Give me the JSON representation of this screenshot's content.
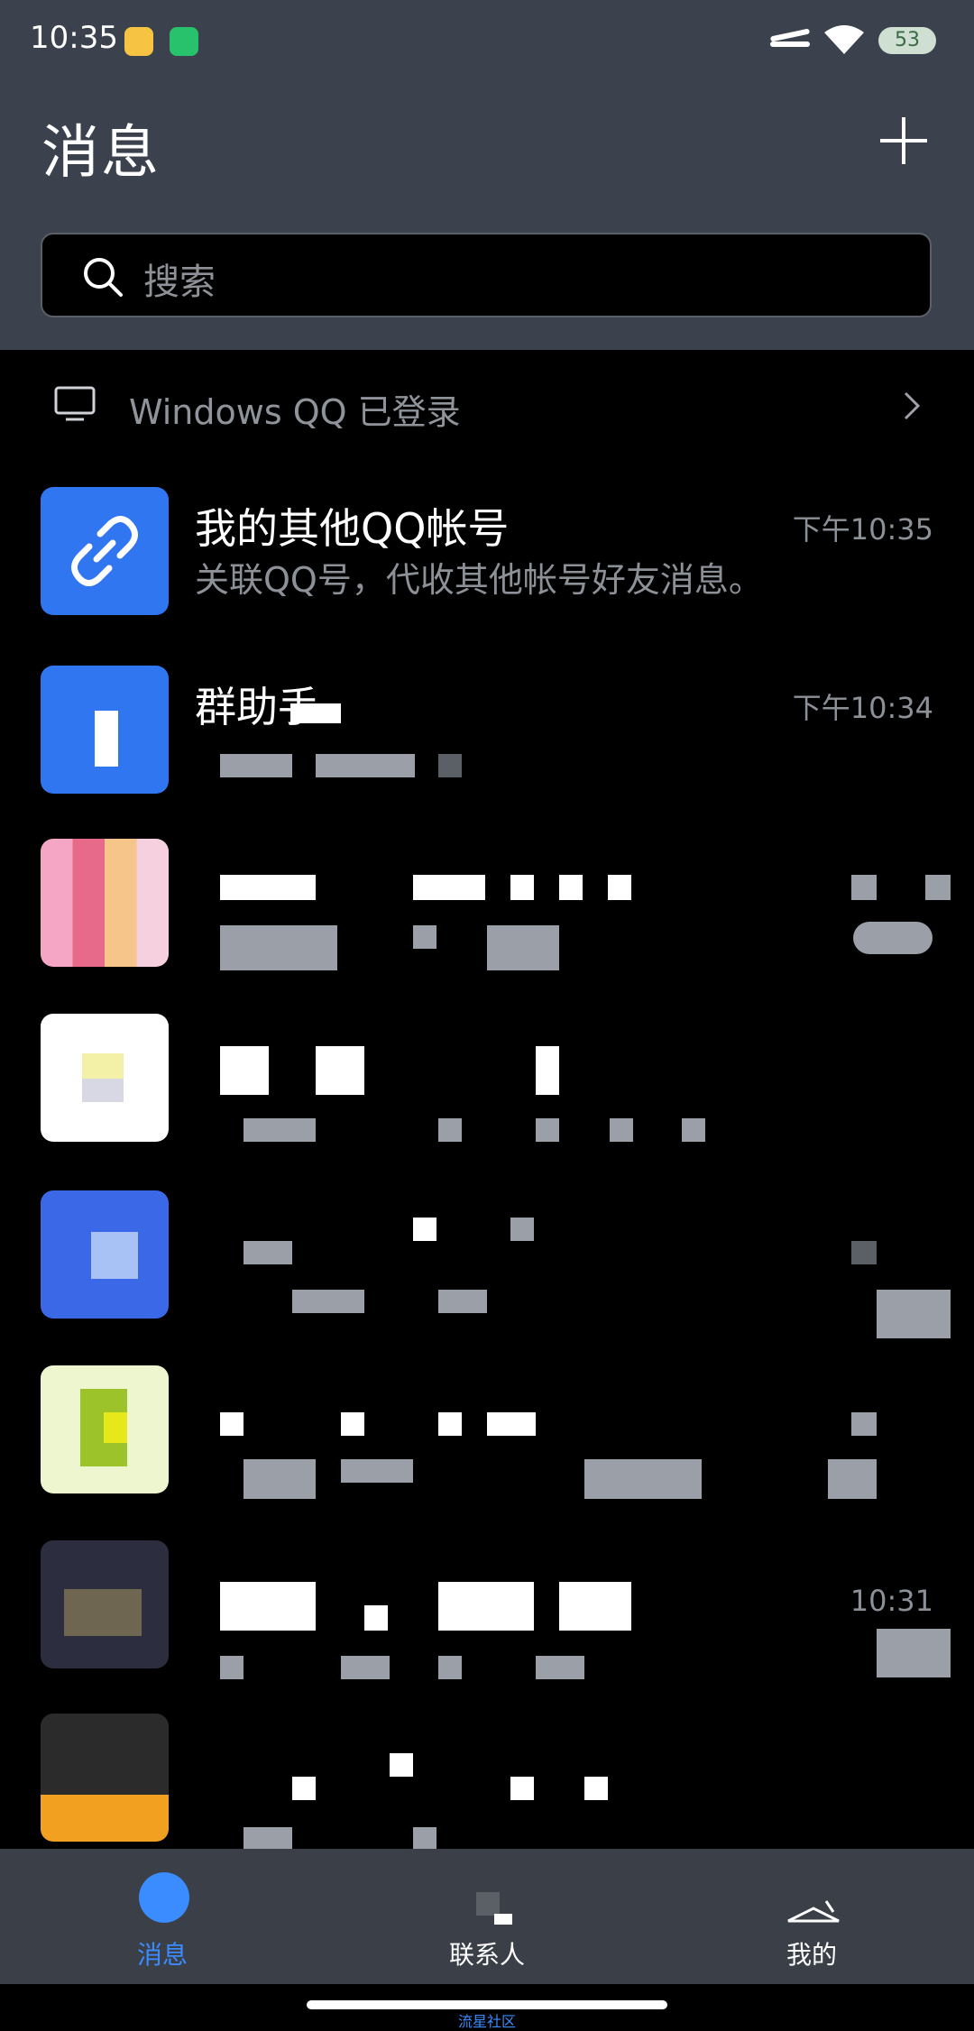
{
  "status_bar": {
    "time": "10:35",
    "battery": "53"
  },
  "header": {
    "title": "消息"
  },
  "search": {
    "placeholder": "搜索"
  },
  "pc_login": {
    "text": "Windows QQ 已登录"
  },
  "chats": [
    {
      "name": "我的其他QQ帐号",
      "preview": "关联QQ号，代收其他帐号好友消息。",
      "time": "下午10:35"
    },
    {
      "name": "群助手",
      "time": "下午10:34"
    },
    {
      "time": ""
    },
    {
      "time": ""
    },
    {
      "time": ""
    },
    {
      "time": ""
    },
    {
      "time": "10:31"
    },
    {
      "time": ""
    }
  ],
  "nav": {
    "items": [
      {
        "label": "消息"
      },
      {
        "label": "联系人"
      },
      {
        "label": "我的"
      }
    ]
  },
  "watermark": "流星社区",
  "colors": {
    "header_bg": "#3c424d",
    "accent": "#3b8cff",
    "app_bg": "#000000"
  }
}
